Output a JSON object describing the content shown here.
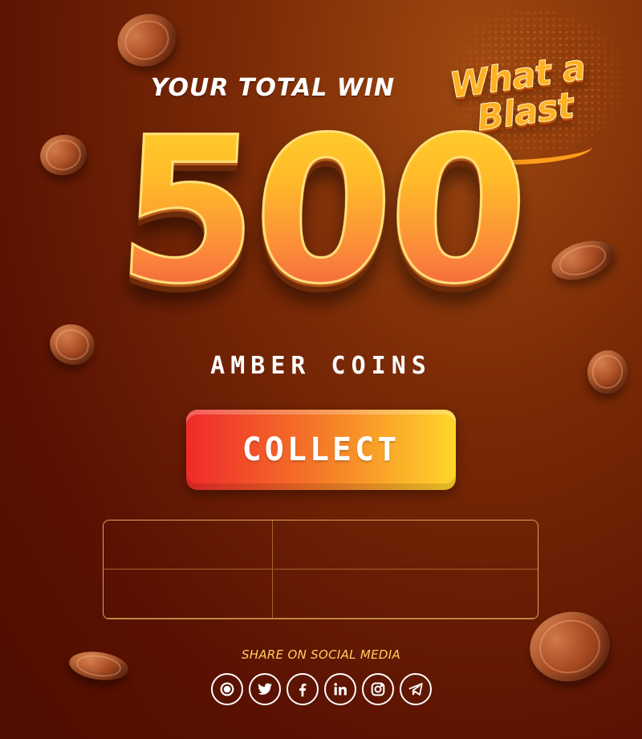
{
  "header": {
    "title": "YOUR TOTAL WIN"
  },
  "badge": {
    "line1": "What a",
    "line2": "Blast"
  },
  "win": {
    "amount": "500",
    "currency": "AMBER COINS"
  },
  "collect_button": {
    "label": "COLLECT"
  },
  "score_table": {
    "rows": [
      [
        "",
        ""
      ],
      [
        "",
        ""
      ],
      [
        "",
        ""
      ]
    ]
  },
  "share": {
    "label": "SHARE ON SOCIAL MEDIA",
    "icons": [
      "target-icon",
      "twitter-icon",
      "facebook-icon",
      "linkedin-icon",
      "instagram-icon",
      "telegram-icon"
    ]
  },
  "colors": {
    "background": "#5a1102",
    "accent_gold": "#ffd22b",
    "accent_orange": "#f57a28",
    "accent_red": "#ef2a2a",
    "share_text": "#ffd060"
  }
}
